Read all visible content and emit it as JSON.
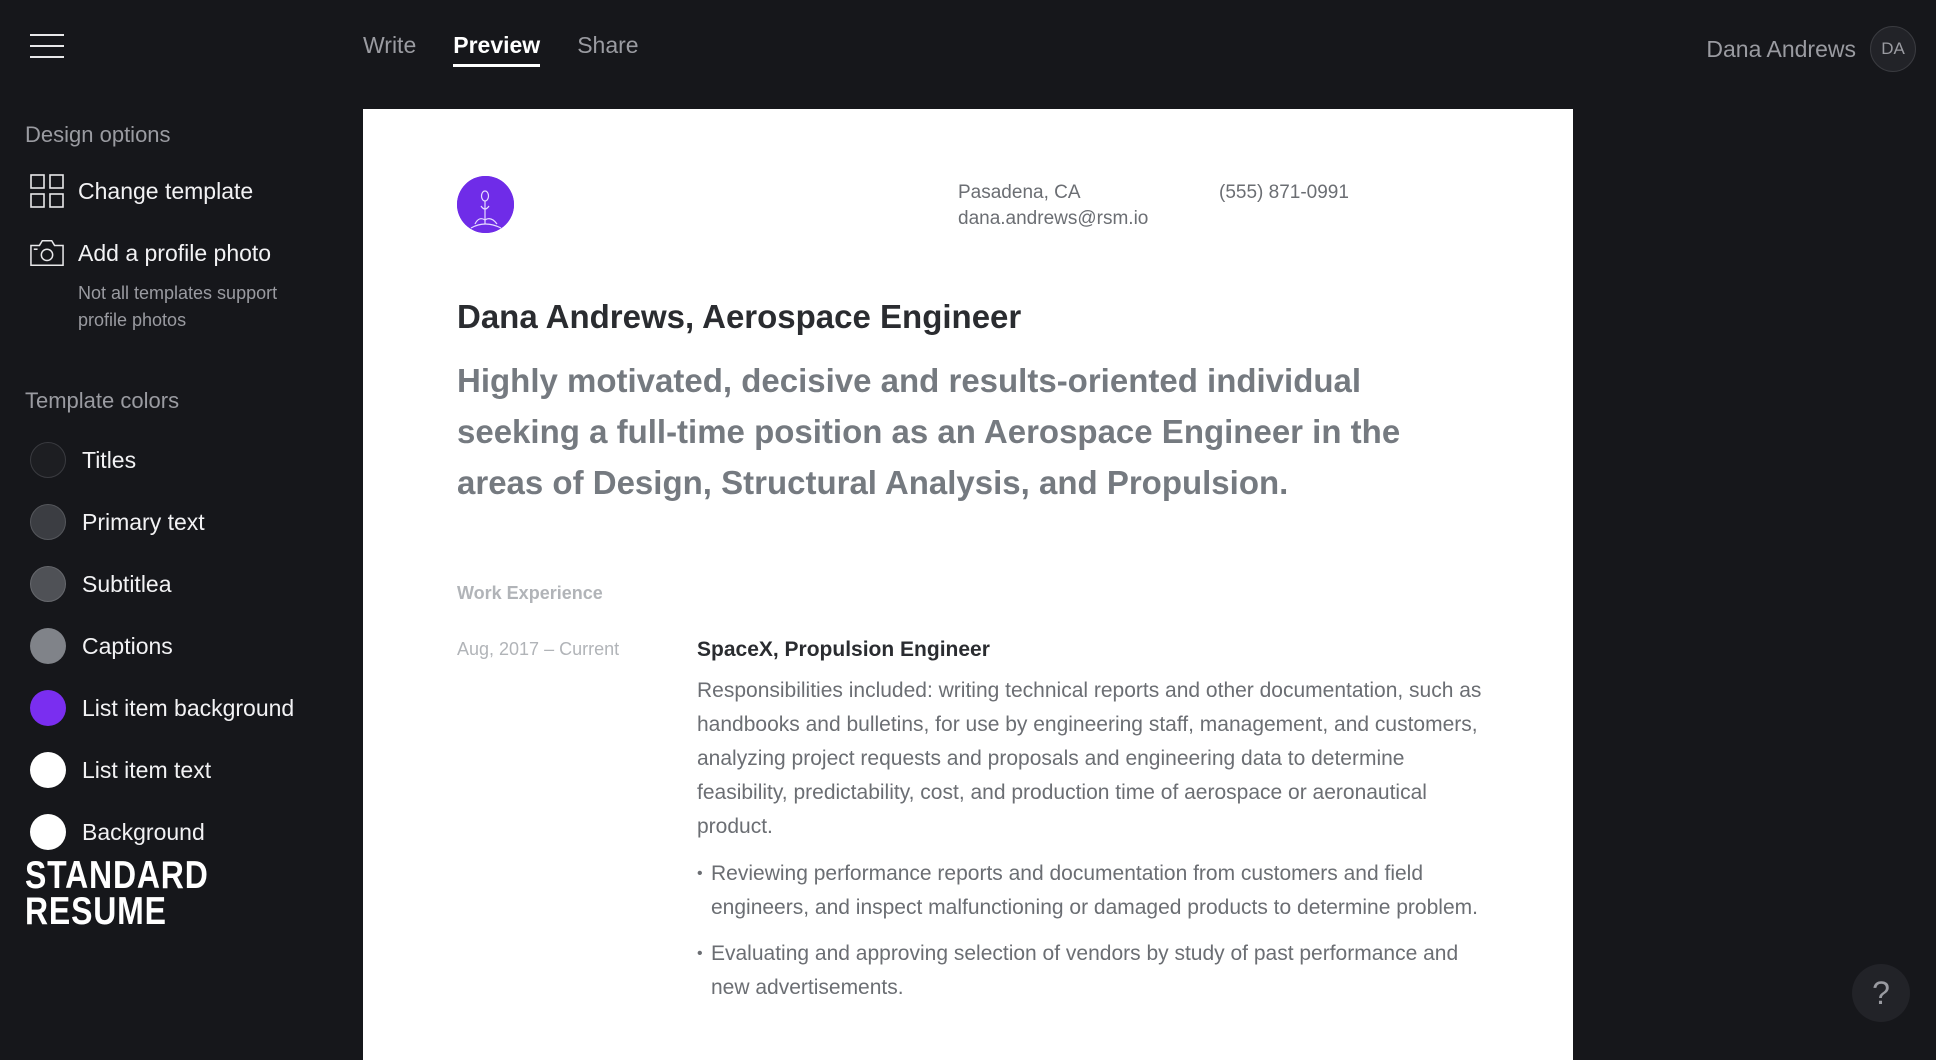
{
  "nav": {
    "tabs": [
      {
        "label": "Write"
      },
      {
        "label": "Preview"
      },
      {
        "label": "Share"
      }
    ]
  },
  "user": {
    "name": "Dana Andrews",
    "initials": "DA"
  },
  "sidebar": {
    "design_title": "Design options",
    "change_template": "Change template",
    "add_photo": "Add a profile photo",
    "photo_hint": "Not all templates support profile photos",
    "colors_title": "Template colors",
    "colors": [
      {
        "label": "Titles",
        "color": "#1d1e22"
      },
      {
        "label": "Primary text",
        "color": "#3b3d42"
      },
      {
        "label": "Subtitlea",
        "color": "#4f5156"
      },
      {
        "label": "Captions",
        "color": "#808389"
      },
      {
        "label": "List item background",
        "color": "#7a2ef0"
      },
      {
        "label": "List item text",
        "color": "#ffffff"
      },
      {
        "label": "Background",
        "color": "#ffffff"
      }
    ],
    "logo_line1": "STANDARD",
    "logo_line2": "RESUME"
  },
  "resume": {
    "location": "Pasadena, CA",
    "email": "dana.andrews@rsm.io",
    "phone": "(555) 871-0991",
    "name_title": "Dana Andrews, Aerospace Engineer",
    "summary": "Highly motivated, decisive and results-oriented individual seeking a full-time position as an Aerospace Engineer in the areas of Design, Structural Analysis, and Propulsion.",
    "section_work": "Work Experience",
    "job": {
      "date": "Aug, 2017 – Current",
      "title": "SpaceX, Propulsion Engineer",
      "description": "Responsibilities included: writing technical reports and other documentation, such as handbooks and bulletins, for use by engineering staff, management, and customers, analyzing project requests and proposals and engineering data to determine feasibility, predictability, cost, and production time of aerospace or aeronautical product.",
      "bullets": [
        "Reviewing performance reports and documentation from customers and field engineers, and inspect malfunctioning or damaged products to determine problem.",
        "Evaluating and approving selection of vendors by study of past performance and new advertisements."
      ]
    }
  },
  "help": {
    "label": "?"
  }
}
